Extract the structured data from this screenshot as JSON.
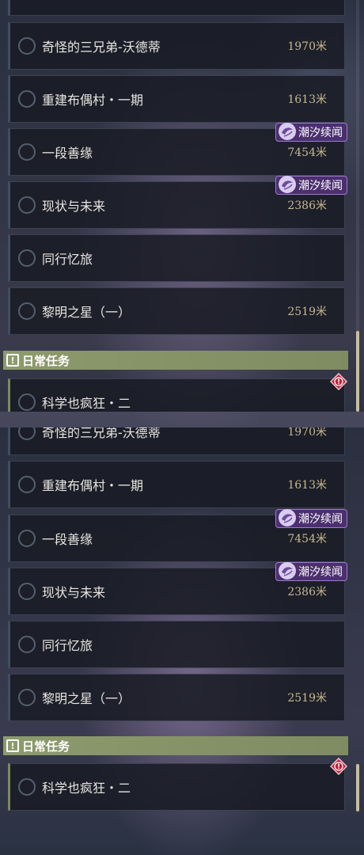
{
  "quests": [
    {
      "name": "奇怪的三兄弟-沃德蒂",
      "distance": "1970米"
    },
    {
      "name": "重建布偶村・一期",
      "distance": "1613米"
    },
    {
      "name": "一段善缘",
      "distance": "7454米",
      "badge": "潮汐续闻"
    },
    {
      "name": "现状与未来",
      "distance": "2386米",
      "badge": "潮汐续闻"
    },
    {
      "name": "同行忆旅",
      "distance": ""
    },
    {
      "name": "黎明之星（一）",
      "distance": "2519米"
    }
  ],
  "daily_section": {
    "label": "日常任务",
    "icon": "exclamation-icon"
  },
  "daily_quests": [
    {
      "name": "科学也疯狂・二",
      "alert_icon": "alert-diamond-icon"
    }
  ],
  "colors": {
    "badge_bg": "#4b2f6e",
    "section_bg": "#8d9a6c",
    "distance_text": "#c7b98e",
    "alert": "#c0203a"
  }
}
